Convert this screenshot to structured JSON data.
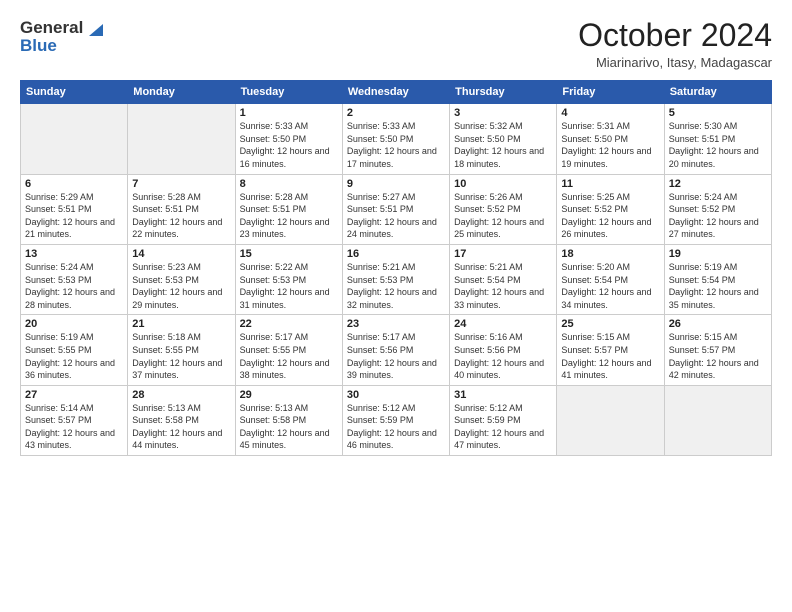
{
  "logo": {
    "general": "General",
    "blue": "Blue"
  },
  "title": "October 2024",
  "location": "Miarinarivo, Itasy, Madagascar",
  "days_of_week": [
    "Sunday",
    "Monday",
    "Tuesday",
    "Wednesday",
    "Thursday",
    "Friday",
    "Saturday"
  ],
  "weeks": [
    [
      {
        "day": "",
        "sunrise": "",
        "sunset": "",
        "daylight": ""
      },
      {
        "day": "",
        "sunrise": "",
        "sunset": "",
        "daylight": ""
      },
      {
        "day": "1",
        "sunrise": "Sunrise: 5:33 AM",
        "sunset": "Sunset: 5:50 PM",
        "daylight": "Daylight: 12 hours and 16 minutes."
      },
      {
        "day": "2",
        "sunrise": "Sunrise: 5:33 AM",
        "sunset": "Sunset: 5:50 PM",
        "daylight": "Daylight: 12 hours and 17 minutes."
      },
      {
        "day": "3",
        "sunrise": "Sunrise: 5:32 AM",
        "sunset": "Sunset: 5:50 PM",
        "daylight": "Daylight: 12 hours and 18 minutes."
      },
      {
        "day": "4",
        "sunrise": "Sunrise: 5:31 AM",
        "sunset": "Sunset: 5:50 PM",
        "daylight": "Daylight: 12 hours and 19 minutes."
      },
      {
        "day": "5",
        "sunrise": "Sunrise: 5:30 AM",
        "sunset": "Sunset: 5:51 PM",
        "daylight": "Daylight: 12 hours and 20 minutes."
      }
    ],
    [
      {
        "day": "6",
        "sunrise": "Sunrise: 5:29 AM",
        "sunset": "Sunset: 5:51 PM",
        "daylight": "Daylight: 12 hours and 21 minutes."
      },
      {
        "day": "7",
        "sunrise": "Sunrise: 5:28 AM",
        "sunset": "Sunset: 5:51 PM",
        "daylight": "Daylight: 12 hours and 22 minutes."
      },
      {
        "day": "8",
        "sunrise": "Sunrise: 5:28 AM",
        "sunset": "Sunset: 5:51 PM",
        "daylight": "Daylight: 12 hours and 23 minutes."
      },
      {
        "day": "9",
        "sunrise": "Sunrise: 5:27 AM",
        "sunset": "Sunset: 5:51 PM",
        "daylight": "Daylight: 12 hours and 24 minutes."
      },
      {
        "day": "10",
        "sunrise": "Sunrise: 5:26 AM",
        "sunset": "Sunset: 5:52 PM",
        "daylight": "Daylight: 12 hours and 25 minutes."
      },
      {
        "day": "11",
        "sunrise": "Sunrise: 5:25 AM",
        "sunset": "Sunset: 5:52 PM",
        "daylight": "Daylight: 12 hours and 26 minutes."
      },
      {
        "day": "12",
        "sunrise": "Sunrise: 5:24 AM",
        "sunset": "Sunset: 5:52 PM",
        "daylight": "Daylight: 12 hours and 27 minutes."
      }
    ],
    [
      {
        "day": "13",
        "sunrise": "Sunrise: 5:24 AM",
        "sunset": "Sunset: 5:53 PM",
        "daylight": "Daylight: 12 hours and 28 minutes."
      },
      {
        "day": "14",
        "sunrise": "Sunrise: 5:23 AM",
        "sunset": "Sunset: 5:53 PM",
        "daylight": "Daylight: 12 hours and 29 minutes."
      },
      {
        "day": "15",
        "sunrise": "Sunrise: 5:22 AM",
        "sunset": "Sunset: 5:53 PM",
        "daylight": "Daylight: 12 hours and 31 minutes."
      },
      {
        "day": "16",
        "sunrise": "Sunrise: 5:21 AM",
        "sunset": "Sunset: 5:53 PM",
        "daylight": "Daylight: 12 hours and 32 minutes."
      },
      {
        "day": "17",
        "sunrise": "Sunrise: 5:21 AM",
        "sunset": "Sunset: 5:54 PM",
        "daylight": "Daylight: 12 hours and 33 minutes."
      },
      {
        "day": "18",
        "sunrise": "Sunrise: 5:20 AM",
        "sunset": "Sunset: 5:54 PM",
        "daylight": "Daylight: 12 hours and 34 minutes."
      },
      {
        "day": "19",
        "sunrise": "Sunrise: 5:19 AM",
        "sunset": "Sunset: 5:54 PM",
        "daylight": "Daylight: 12 hours and 35 minutes."
      }
    ],
    [
      {
        "day": "20",
        "sunrise": "Sunrise: 5:19 AM",
        "sunset": "Sunset: 5:55 PM",
        "daylight": "Daylight: 12 hours and 36 minutes."
      },
      {
        "day": "21",
        "sunrise": "Sunrise: 5:18 AM",
        "sunset": "Sunset: 5:55 PM",
        "daylight": "Daylight: 12 hours and 37 minutes."
      },
      {
        "day": "22",
        "sunrise": "Sunrise: 5:17 AM",
        "sunset": "Sunset: 5:55 PM",
        "daylight": "Daylight: 12 hours and 38 minutes."
      },
      {
        "day": "23",
        "sunrise": "Sunrise: 5:17 AM",
        "sunset": "Sunset: 5:56 PM",
        "daylight": "Daylight: 12 hours and 39 minutes."
      },
      {
        "day": "24",
        "sunrise": "Sunrise: 5:16 AM",
        "sunset": "Sunset: 5:56 PM",
        "daylight": "Daylight: 12 hours and 40 minutes."
      },
      {
        "day": "25",
        "sunrise": "Sunrise: 5:15 AM",
        "sunset": "Sunset: 5:57 PM",
        "daylight": "Daylight: 12 hours and 41 minutes."
      },
      {
        "day": "26",
        "sunrise": "Sunrise: 5:15 AM",
        "sunset": "Sunset: 5:57 PM",
        "daylight": "Daylight: 12 hours and 42 minutes."
      }
    ],
    [
      {
        "day": "27",
        "sunrise": "Sunrise: 5:14 AM",
        "sunset": "Sunset: 5:57 PM",
        "daylight": "Daylight: 12 hours and 43 minutes."
      },
      {
        "day": "28",
        "sunrise": "Sunrise: 5:13 AM",
        "sunset": "Sunset: 5:58 PM",
        "daylight": "Daylight: 12 hours and 44 minutes."
      },
      {
        "day": "29",
        "sunrise": "Sunrise: 5:13 AM",
        "sunset": "Sunset: 5:58 PM",
        "daylight": "Daylight: 12 hours and 45 minutes."
      },
      {
        "day": "30",
        "sunrise": "Sunrise: 5:12 AM",
        "sunset": "Sunset: 5:59 PM",
        "daylight": "Daylight: 12 hours and 46 minutes."
      },
      {
        "day": "31",
        "sunrise": "Sunrise: 5:12 AM",
        "sunset": "Sunset: 5:59 PM",
        "daylight": "Daylight: 12 hours and 47 minutes."
      },
      {
        "day": "",
        "sunrise": "",
        "sunset": "",
        "daylight": ""
      },
      {
        "day": "",
        "sunrise": "",
        "sunset": "",
        "daylight": ""
      }
    ]
  ]
}
